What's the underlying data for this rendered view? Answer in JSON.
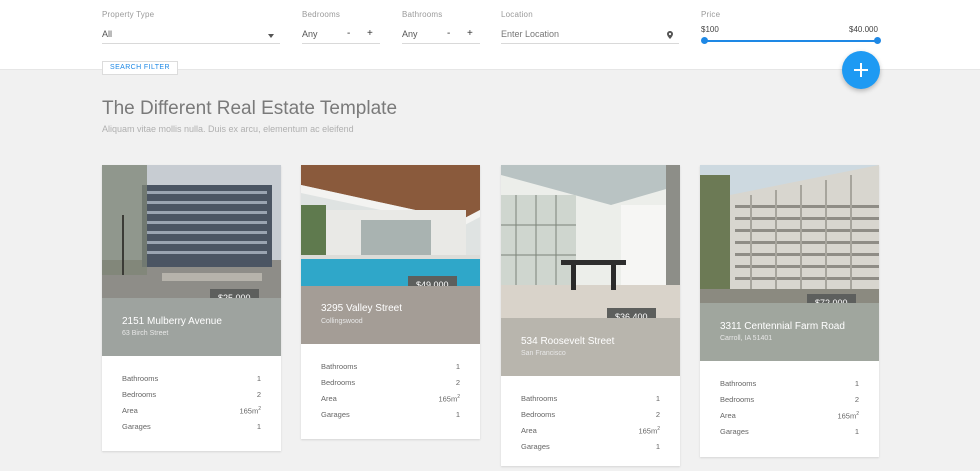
{
  "filters": {
    "property_type": {
      "label": "Property Type",
      "value": "All"
    },
    "bedrooms": {
      "label": "Bedrooms",
      "value": "Any",
      "minus": "-",
      "plus": "+"
    },
    "bathrooms": {
      "label": "Bathrooms",
      "value": "Any",
      "minus": "-",
      "plus": "+"
    },
    "location": {
      "label": "Location",
      "placeholder": "Enter Location"
    },
    "price": {
      "label": "Price",
      "min": "$100",
      "max": "$40.000"
    },
    "search_button": "SEARCH FILTER"
  },
  "heading": {
    "title": "The Different Real Estate Template",
    "subtitle": "Aliquam vitae mollis nulla. Duis ex arcu, elementum ac eleifend"
  },
  "colors": {
    "accent": "#1e88e5",
    "fab": "#1e9af3"
  },
  "spec_labels": {
    "bathrooms": "Bathrooms",
    "bedrooms": "Bedrooms",
    "area": "Area",
    "garages": "Garages"
  },
  "listings": [
    {
      "price": "$25.000",
      "street": "2151 Mulberry Avenue",
      "city": "63 Birch Street",
      "bathrooms": "1",
      "bedrooms": "2",
      "area": "165m",
      "area_unit": "2",
      "garages": "1"
    },
    {
      "price": "$49.000",
      "street": "3295 Valley Street",
      "city": "Collingswood",
      "bathrooms": "1",
      "bedrooms": "2",
      "area": "165m",
      "area_unit": "2",
      "garages": "1"
    },
    {
      "price": "$36.400",
      "street": "534 Roosevelt Street",
      "city": "San Francisco",
      "bathrooms": "1",
      "bedrooms": "2",
      "area": "165m",
      "area_unit": "2",
      "garages": "1"
    },
    {
      "price": "$72.000",
      "street": "3311 Centennial Farm Road",
      "city": "Carroll, IA 51401",
      "bathrooms": "1",
      "bedrooms": "2",
      "area": "165m",
      "area_unit": "2",
      "garages": "1"
    }
  ]
}
